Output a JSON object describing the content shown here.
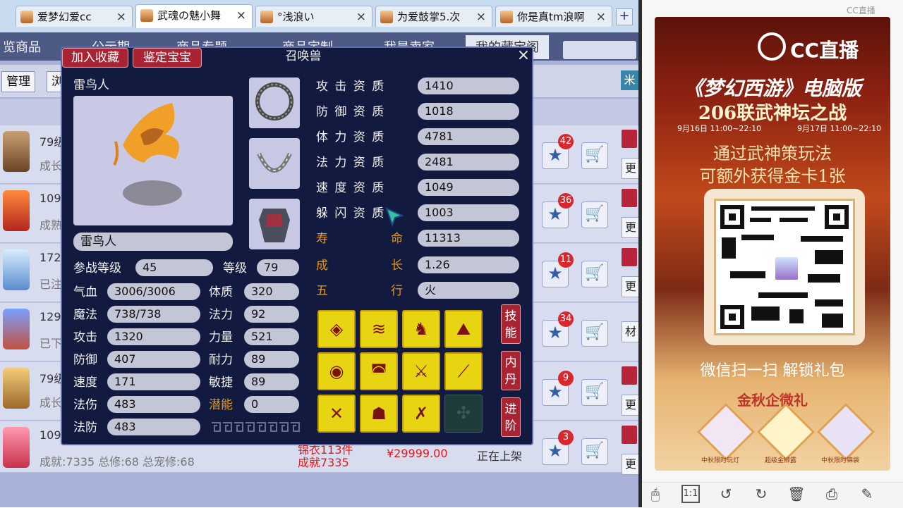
{
  "tabs": [
    {
      "title": "爱梦幻爱cc",
      "active": false
    },
    {
      "title": "武魂の魅小舞",
      "active": true
    },
    {
      "title": "°浅浪い",
      "active": false
    },
    {
      "title": "为爱鼓掌5.次",
      "active": false
    },
    {
      "title": "你是真tm浪啊",
      "active": false
    }
  ],
  "new_tab_label": "+",
  "menu": {
    "items": [
      "览商品",
      "公示期",
      "商品专题",
      "商品定制",
      "我是卖家",
      "我的藏宝阁"
    ],
    "manage_label": "管理",
    "filter_label": "浏",
    "side_label": "米"
  },
  "list_rows": [
    {
      "level": "79级",
      "sub": "成长",
      "fav_count": "42",
      "side": "更"
    },
    {
      "level": "109",
      "sub": "成熟",
      "fav_count": "36",
      "side": "更"
    },
    {
      "level": "172",
      "sub": "已注",
      "fav_count": "11",
      "side": "更"
    },
    {
      "level": "129",
      "sub": "已下",
      "fav_count": "34",
      "side": "材"
    },
    {
      "level": "79级",
      "sub": "成长",
      "fav_count": "9",
      "side": "更"
    },
    {
      "level": "109",
      "sub": "成就:7335 总修:68 总宠修:68",
      "fav_count": "3",
      "side": "更"
    }
  ],
  "row_bottom": {
    "red_line1": "锦衣113件",
    "red_line2": "成就7335",
    "price": "¥29999.00",
    "status": "正在上架"
  },
  "dialog": {
    "btn_collect": "加入收藏",
    "btn_appraise": "鉴定宝宝",
    "title": "召唤兽",
    "close": "×",
    "pet_name": "雷鸟人",
    "pet_name_field": "雷鸟人",
    "left_stats": [
      {
        "label": "参战等级",
        "value": "45"
      },
      {
        "label": "气血",
        "value": "3006/3006"
      },
      {
        "label": "魔法",
        "value": "738/738"
      },
      {
        "label": "攻击",
        "value": "1320"
      },
      {
        "label": "防御",
        "value": "407"
      },
      {
        "label": "速度",
        "value": "171"
      },
      {
        "label": "法伤",
        "value": "483"
      },
      {
        "label": "法防",
        "value": "483"
      }
    ],
    "mid_stats": [
      {
        "label": "等级",
        "value": "79"
      },
      {
        "label": "体质",
        "value": "320"
      },
      {
        "label": "法力",
        "value": "92"
      },
      {
        "label": "力量",
        "value": "521"
      },
      {
        "label": "耐力",
        "value": "89"
      },
      {
        "label": "敏捷",
        "value": "89"
      },
      {
        "label": "潜能",
        "value": "0"
      }
    ],
    "aptitudes": [
      {
        "label": "攻 击 资 质",
        "value": "1410"
      },
      {
        "label": "防 御 资 质",
        "value": "1018"
      },
      {
        "label": "体 力 资 质",
        "value": "4781"
      },
      {
        "label": "法 力 资 质",
        "value": "2481"
      },
      {
        "label": "速 度 资 质",
        "value": "1049"
      },
      {
        "label": "躲 闪 资 质",
        "value": "1003"
      }
    ],
    "special": [
      {
        "left": "寿",
        "right": "命",
        "value": "11313"
      },
      {
        "left": "成",
        "right": "长",
        "value": "1.26"
      },
      {
        "left": "五",
        "right": "行",
        "value": "火"
      }
    ],
    "side_tabs": [
      "技能",
      "内丹",
      "进阶"
    ],
    "skill_icons": [
      "shield-icon",
      "claw-icon",
      "figure-icon",
      "mountain-icon",
      "eye-icon",
      "mouth-icon",
      "sword-icon",
      "slash-icon",
      "crossed-swords-icon",
      "owl-icon",
      "crossed-blades-icon",
      "empty-slot-icon"
    ]
  },
  "ad": {
    "brand": "CC直播",
    "corner": "CC直播",
    "title_line1": "《梦幻西游》电脑版",
    "title_line2": "206联武神坛之战",
    "date1": "9月16日 11:00~22:10",
    "date2": "9月17日 11:00~22:10",
    "promo_line1": "通过武神策玩法",
    "promo_line2": "可额外获得金卡1张",
    "scan_text": "微信扫一扫 解锁礼包",
    "gift_title": "金秋企微礼",
    "gift1": "中秋限时玩灯",
    "gift2": "超级金柳露",
    "gift3": "中秋限时锦袋"
  },
  "toolbar_icons": [
    "mouse-icon",
    "actual-size-icon",
    "rotate-left-icon",
    "rotate-right-icon",
    "delete-icon",
    "print-icon",
    "edit-icon"
  ],
  "colors": {
    "dialog_bg": "#121b3f",
    "button_red": "#a92433",
    "gold_label": "#e69a1c",
    "skill_yellow": "#e7d412"
  }
}
